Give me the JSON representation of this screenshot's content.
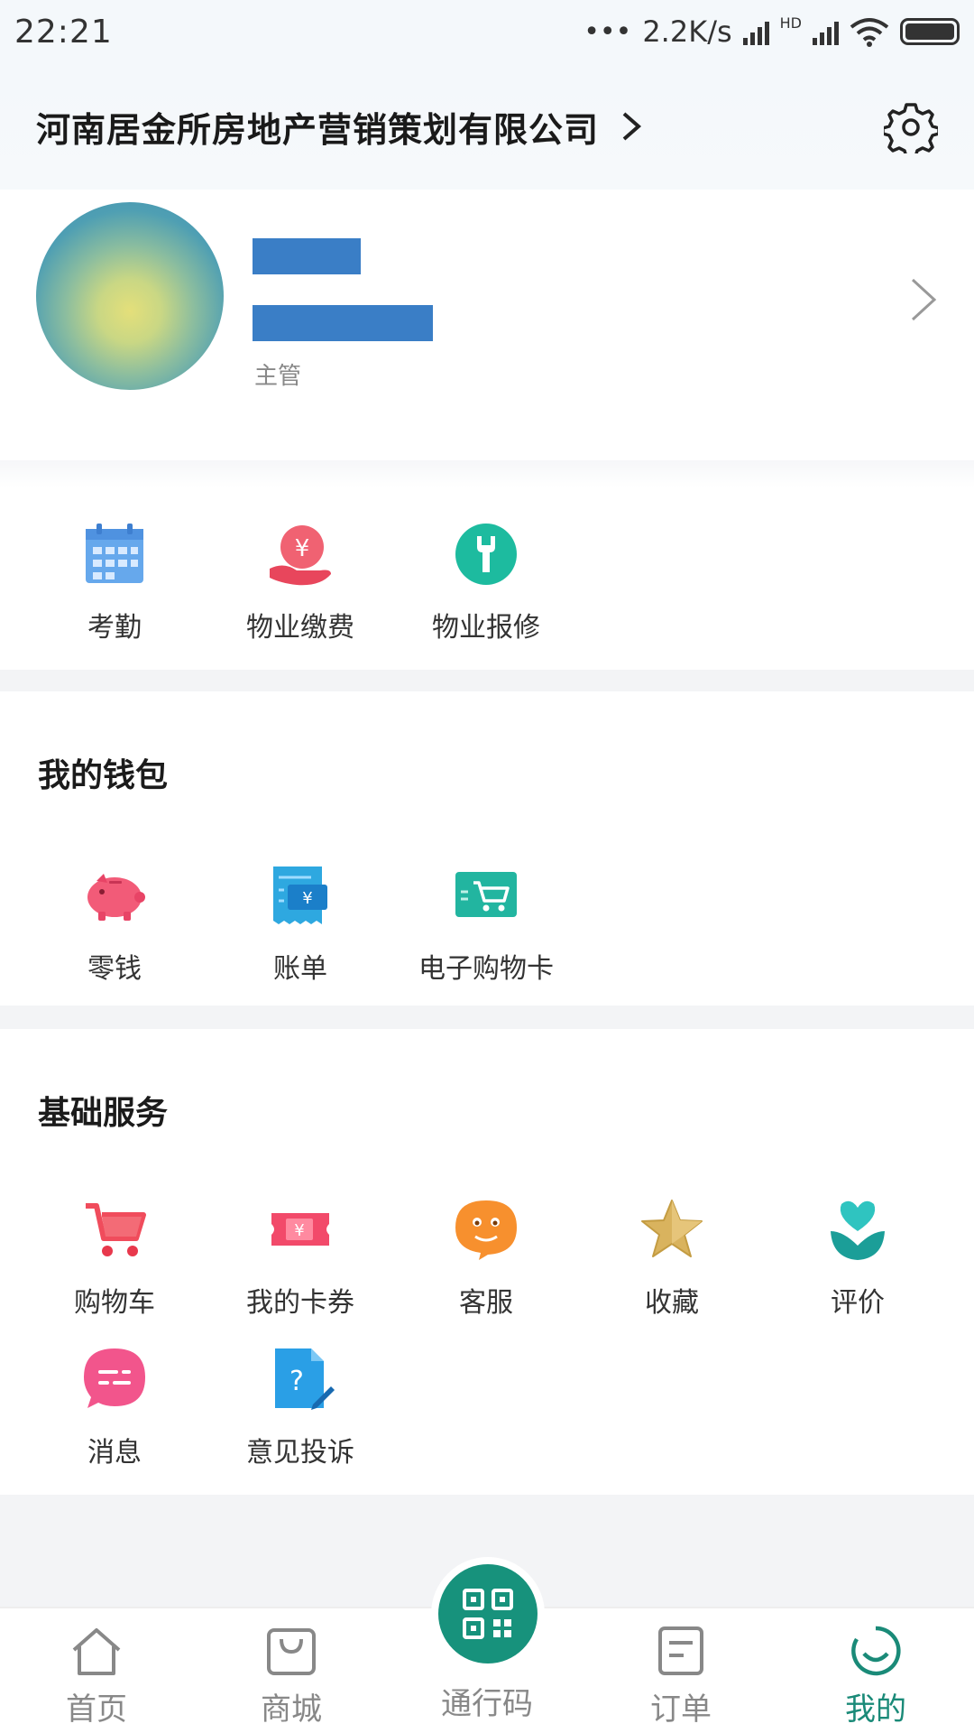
{
  "status_bar": {
    "time": "22:21",
    "net_speed": "2.2K/s",
    "hd": "HD"
  },
  "header": {
    "company": "河南居金所房地产营销策划有限公司"
  },
  "profile": {
    "role": "主管"
  },
  "quick_actions": [
    {
      "label": "考勤",
      "icon": "calendar-icon"
    },
    {
      "label": "物业缴费",
      "icon": "payment-hand-icon"
    },
    {
      "label": "物业报修",
      "icon": "repair-wrench-icon"
    }
  ],
  "wallet": {
    "title": "我的钱包",
    "items": [
      {
        "label": "零钱",
        "icon": "piggy-bank-icon"
      },
      {
        "label": "账单",
        "icon": "bill-icon"
      },
      {
        "label": "电子购物卡",
        "icon": "shopping-card-icon"
      }
    ]
  },
  "services": {
    "title": "基础服务",
    "items": [
      {
        "label": "购物车",
        "icon": "cart-icon"
      },
      {
        "label": "我的卡券",
        "icon": "coupon-icon"
      },
      {
        "label": "客服",
        "icon": "customer-service-icon"
      },
      {
        "label": "收藏",
        "icon": "star-icon"
      },
      {
        "label": "评价",
        "icon": "heart-plant-icon"
      },
      {
        "label": "消息",
        "icon": "message-icon"
      },
      {
        "label": "意见投诉",
        "icon": "feedback-icon"
      }
    ]
  },
  "tabbar": {
    "tabs": [
      {
        "label": "首页",
        "icon": "home-icon"
      },
      {
        "label": "商城",
        "icon": "shop-bag-icon"
      },
      {
        "label": "通行码",
        "icon": "qr-code-icon"
      },
      {
        "label": "订单",
        "icon": "order-icon"
      },
      {
        "label": "我的",
        "icon": "profile-smile-icon"
      }
    ],
    "active": "我的",
    "active_color": "#1a8a78"
  },
  "colors": {
    "accent": "#17927c",
    "redaction": "#3a7ec6"
  }
}
